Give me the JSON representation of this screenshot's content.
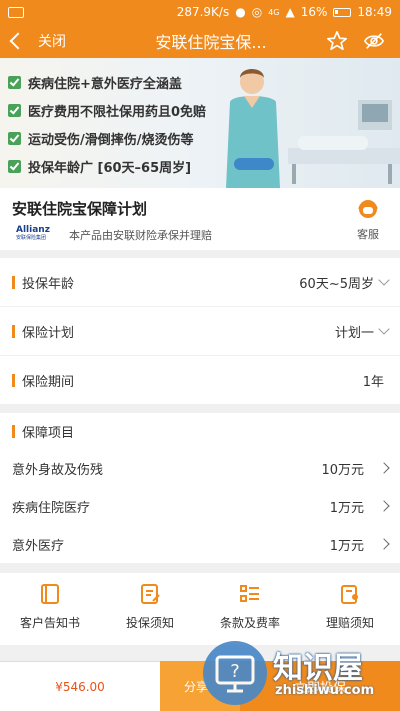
{
  "status_bar": {
    "speed": "287.9K/s",
    "network": "4G",
    "battery": "16%",
    "time": "18:49"
  },
  "nav": {
    "close_label": "关闭",
    "title": "安联住院宝保..."
  },
  "banner": {
    "items": [
      "疾病住院+意外医疗全涵盖",
      "医疗费用不限社保用药且0免赔",
      "运动受伤/滑倒摔伤/烧烫伤等",
      "投保年龄广 [60天–65周岁]"
    ]
  },
  "product": {
    "title": "安联住院宝保障计划",
    "brand_logo": "Allianz",
    "brand_logo_sub": "安联保险集团",
    "underwriter": "本产品由安联财险承保并理赔",
    "service_label": "客服"
  },
  "fields": {
    "age": {
      "label": "投保年龄",
      "value": "60天~5周岁"
    },
    "plan": {
      "label": "保险计划",
      "value": "计划一"
    },
    "period": {
      "label": "保险期间",
      "value": "1年"
    }
  },
  "coverage": {
    "heading": "保障项目",
    "items": [
      {
        "name": "意外身故及伤残",
        "amount": "10万元"
      },
      {
        "name": "疾病住院医疗",
        "amount": "1万元"
      },
      {
        "name": "意外医疗",
        "amount": "1万元"
      }
    ]
  },
  "links": [
    {
      "label": "客户告知书",
      "icon": "book-icon"
    },
    {
      "label": "投保须知",
      "icon": "notice-edit-icon"
    },
    {
      "label": "条款及费率",
      "icon": "list-icon"
    },
    {
      "label": "理赔须知",
      "icon": "claim-user-icon"
    }
  ],
  "bottom": {
    "price": "¥546.00",
    "share": "分享",
    "buy": "立即投保"
  },
  "watermark": {
    "text": "知识屋",
    "sub": "zhishiwu.com"
  },
  "colors": {
    "accent": "#f08a1c",
    "price": "#e8531b",
    "check": "#4aa25a"
  }
}
